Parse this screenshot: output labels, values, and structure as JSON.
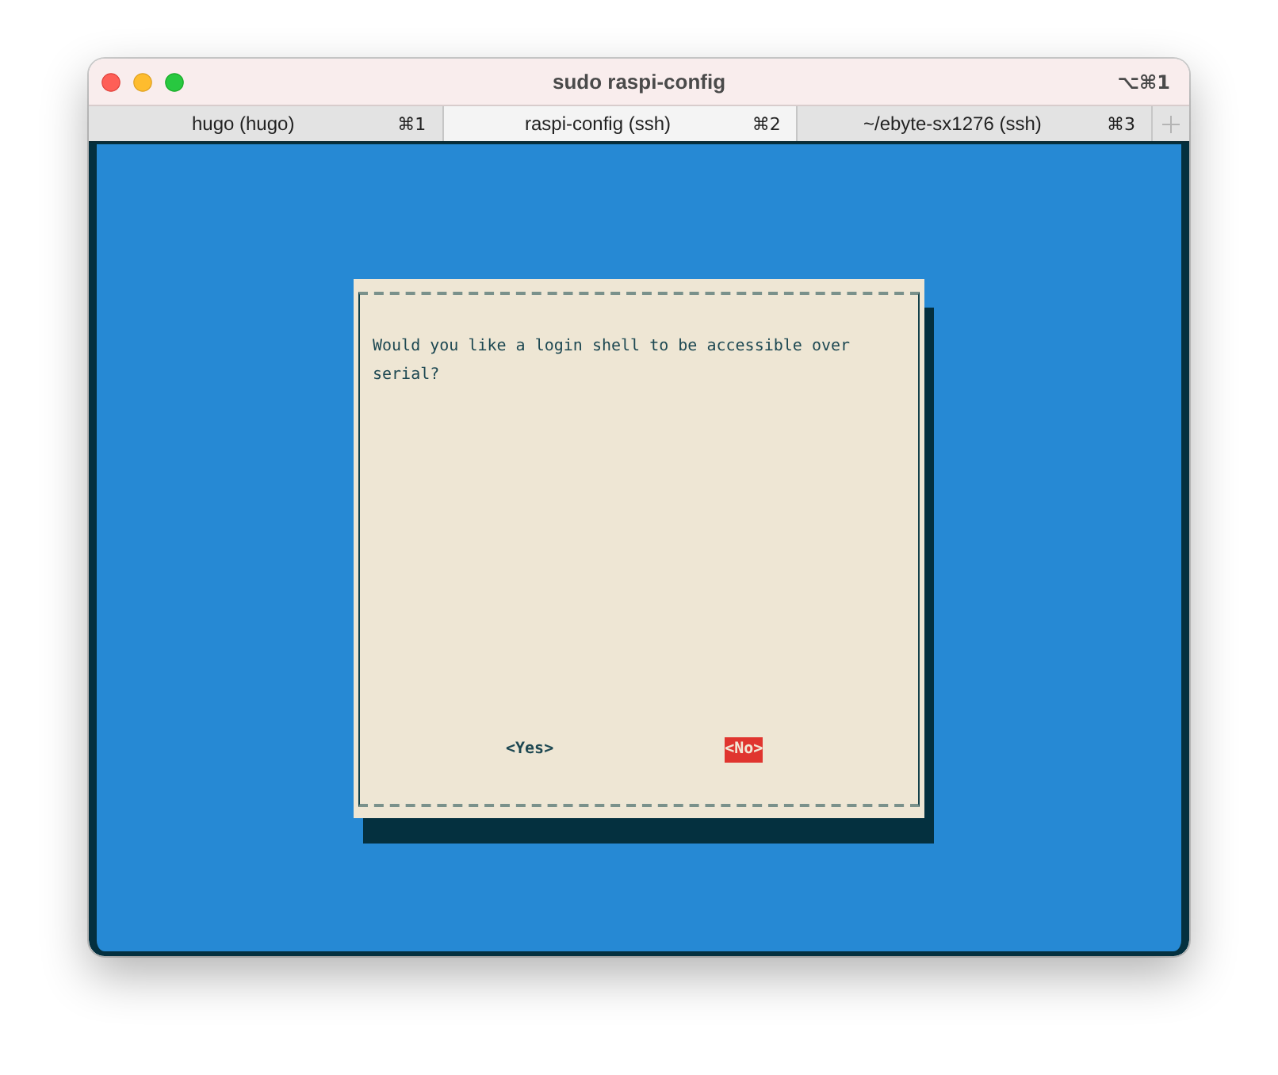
{
  "window": {
    "title": "sudo raspi-config",
    "shortcut": "⌥⌘1"
  },
  "tabs": [
    {
      "label": "hugo (hugo)",
      "shortcut": "⌘1",
      "selected": false
    },
    {
      "label": "raspi-config (ssh)",
      "shortcut": "⌘2",
      "selected": true
    },
    {
      "label": "~/ebyte-sx1276 (ssh)",
      "shortcut": "⌘3",
      "selected": false
    }
  ],
  "dialog": {
    "message": "Would you like a login shell to be accessible over serial?",
    "buttons": [
      {
        "label": "<Yes>",
        "selected": false
      },
      {
        "label": "<No>",
        "selected": true
      }
    ]
  }
}
